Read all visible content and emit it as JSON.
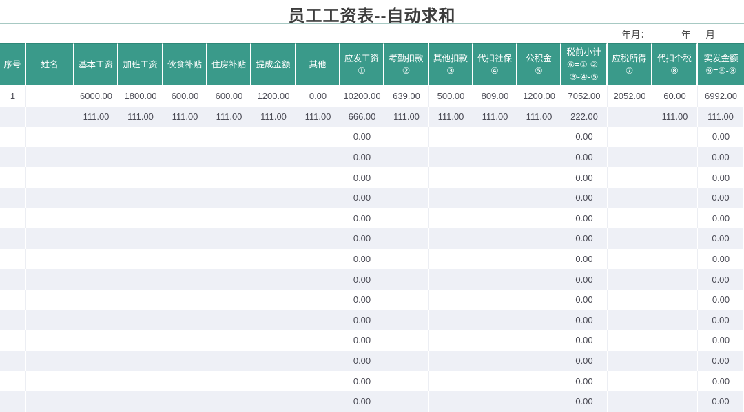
{
  "page": {
    "title": "员工工资表--自动求和",
    "meta": {
      "year_month_label": "年月：",
      "year_label": "年",
      "month_label": "月"
    }
  },
  "colors": {
    "header_bg": "#3a9a8a",
    "header_top_edge": "#2e8878",
    "header_text": "#ffffff",
    "stripe_bg": "#eef0f6",
    "divider_teal": "#a7c9c3",
    "table_bottom_border": "#b9bcc2",
    "title_text": "#3d3d3d",
    "cell_text": "#4b4b55"
  },
  "table": {
    "headers": [
      "序号",
      "姓名",
      "基本工资",
      "加班工资",
      "伙食补贴",
      "住房补贴",
      "提成金额",
      "其他",
      "应发工资\n①",
      "考勤扣款\n②",
      "其他扣款\n③",
      "代扣社保\n④",
      "公积金\n⑤",
      "税前小计\n⑥=①-②-\n③-④-⑤",
      "应税所得\n⑦",
      "代扣个税\n⑧",
      "实发金额\n⑨=⑥-⑧"
    ],
    "rows": [
      [
        "1",
        "",
        "6000.00",
        "1800.00",
        "600.00",
        "600.00",
        "1200.00",
        "0.00",
        "10200.00",
        "639.00",
        "500.00",
        "809.00",
        "1200.00",
        "7052.00",
        "2052.00",
        "60.00",
        "6992.00"
      ],
      [
        "",
        "",
        "111.00",
        "111.00",
        "111.00",
        "111.00",
        "111.00",
        "111.00",
        "666.00",
        "111.00",
        "111.00",
        "111.00",
        "111.00",
        "222.00",
        "",
        "111.00",
        "111.00"
      ],
      [
        "",
        "",
        "",
        "",
        "",
        "",
        "",
        "",
        "0.00",
        "",
        "",
        "",
        "",
        "0.00",
        "",
        "",
        "0.00"
      ],
      [
        "",
        "",
        "",
        "",
        "",
        "",
        "",
        "",
        "0.00",
        "",
        "",
        "",
        "",
        "0.00",
        "",
        "",
        "0.00"
      ],
      [
        "",
        "",
        "",
        "",
        "",
        "",
        "",
        "",
        "0.00",
        "",
        "",
        "",
        "",
        "0.00",
        "",
        "",
        "0.00"
      ],
      [
        "",
        "",
        "",
        "",
        "",
        "",
        "",
        "",
        "0.00",
        "",
        "",
        "",
        "",
        "0.00",
        "",
        "",
        "0.00"
      ],
      [
        "",
        "",
        "",
        "",
        "",
        "",
        "",
        "",
        "0.00",
        "",
        "",
        "",
        "",
        "0.00",
        "",
        "",
        "0.00"
      ],
      [
        "",
        "",
        "",
        "",
        "",
        "",
        "",
        "",
        "0.00",
        "",
        "",
        "",
        "",
        "0.00",
        "",
        "",
        "0.00"
      ],
      [
        "",
        "",
        "",
        "",
        "",
        "",
        "",
        "",
        "0.00",
        "",
        "",
        "",
        "",
        "0.00",
        "",
        "",
        "0.00"
      ],
      [
        "",
        "",
        "",
        "",
        "",
        "",
        "",
        "",
        "0.00",
        "",
        "",
        "",
        "",
        "0.00",
        "",
        "",
        "0.00"
      ],
      [
        "",
        "",
        "",
        "",
        "",
        "",
        "",
        "",
        "0.00",
        "",
        "",
        "",
        "",
        "0.00",
        "",
        "",
        "0.00"
      ],
      [
        "",
        "",
        "",
        "",
        "",
        "",
        "",
        "",
        "0.00",
        "",
        "",
        "",
        "",
        "0.00",
        "",
        "",
        "0.00"
      ],
      [
        "",
        "",
        "",
        "",
        "",
        "",
        "",
        "",
        "0.00",
        "",
        "",
        "",
        "",
        "0.00",
        "",
        "",
        "0.00"
      ],
      [
        "",
        "",
        "",
        "",
        "",
        "",
        "",
        "",
        "0.00",
        "",
        "",
        "",
        "",
        "0.00",
        "",
        "",
        "0.00"
      ],
      [
        "",
        "",
        "",
        "",
        "",
        "",
        "",
        "",
        "0.00",
        "",
        "",
        "",
        "",
        "0.00",
        "",
        "",
        "0.00"
      ],
      [
        "",
        "",
        "",
        "",
        "",
        "",
        "",
        "",
        "0.00",
        "",
        "",
        "",
        "",
        "0.00",
        "",
        "",
        "0.00"
      ]
    ]
  }
}
